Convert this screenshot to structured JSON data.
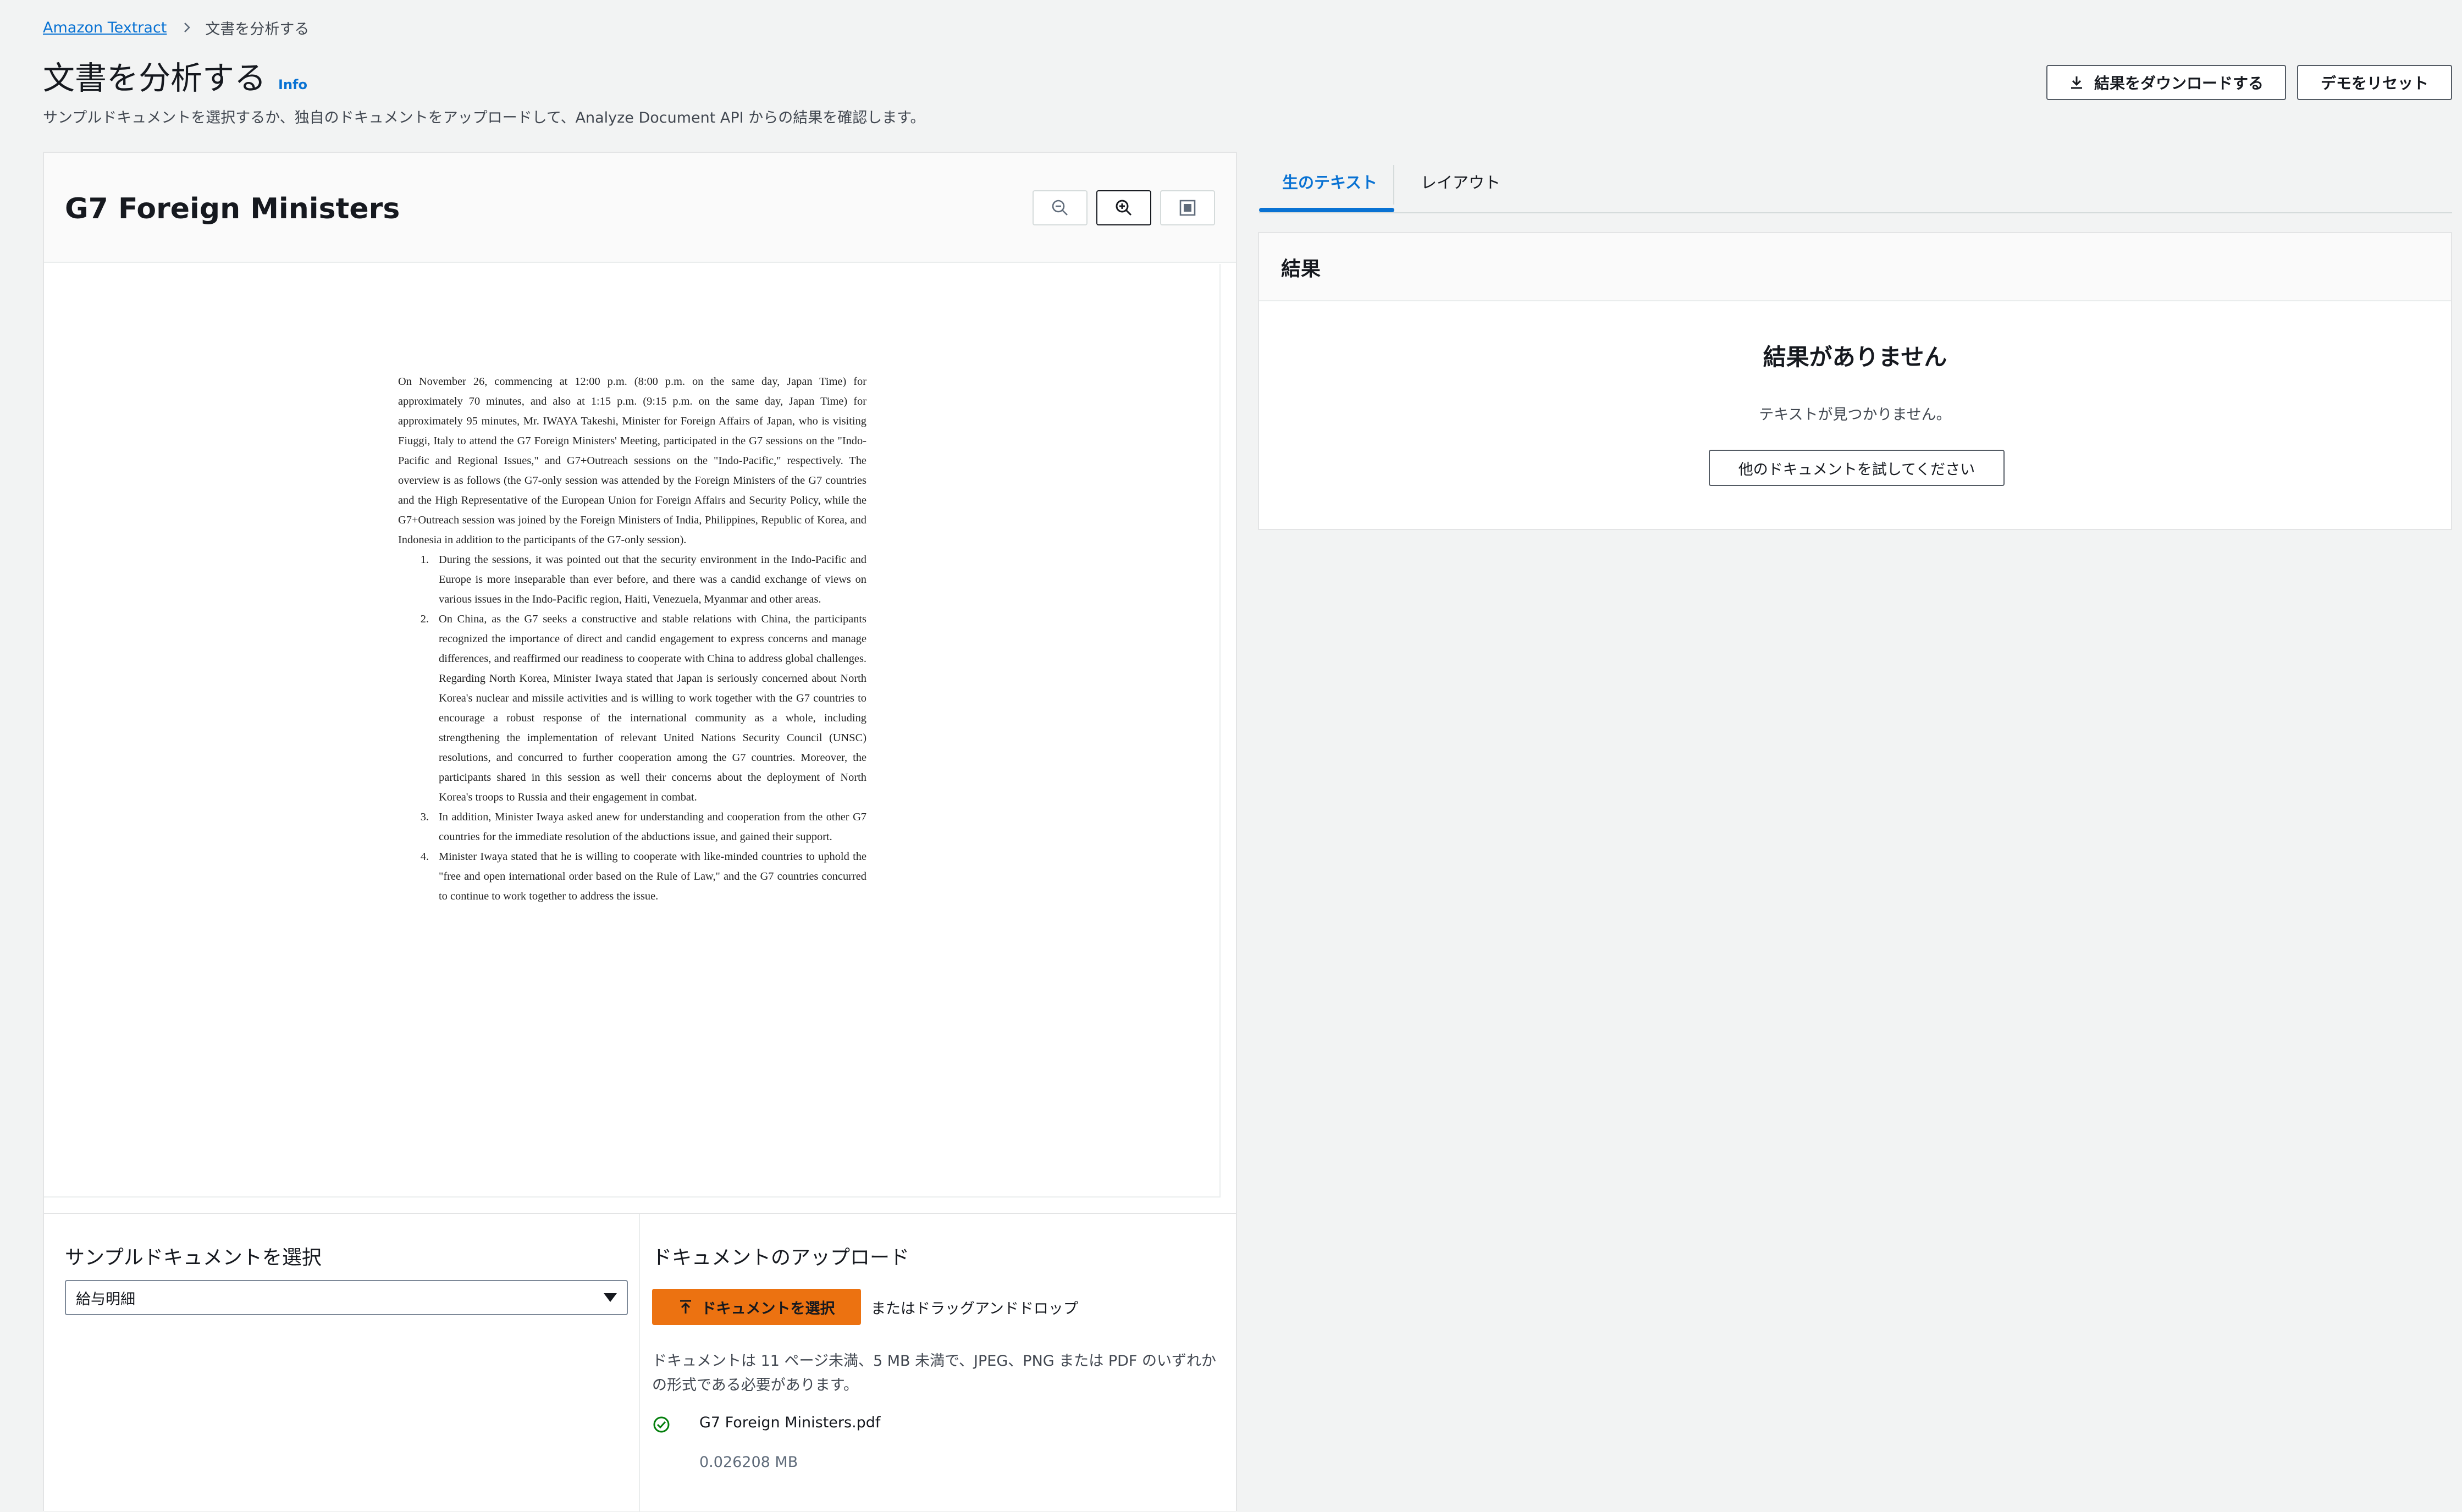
{
  "breadcrumb": {
    "root": "Amazon Textract",
    "current": "文書を分析する"
  },
  "header": {
    "title": "文書を分析する",
    "info": "Info",
    "description": "サンプルドキュメントを選択するか、独自のドキュメントをアップロードして、Analyze Document API からの結果を確認します。",
    "download_label": "結果をダウンロードする",
    "reset_label": "デモをリセット"
  },
  "document": {
    "title": "G7 Foreign Ministers",
    "intro": "On November 26, commencing at 12:00 p.m. (8:00 p.m. on the same day, Japan Time) for approximately 70 minutes, and also at 1:15 p.m. (9:15 p.m. on the same day, Japan Time) for approximately 95 minutes, Mr. IWAYA Takeshi, Minister for Foreign Affairs of Japan, who is visiting Fiuggi, Italy to attend the G7 Foreign Ministers' Meeting, participated in the G7 sessions on the \"Indo-Pacific and Regional Issues,\" and G7+Outreach sessions on the \"Indo-Pacific,\" respectively. The overview is as follows (the G7-only session was attended by the Foreign Ministers of the G7 countries and the High Representative of the European Union for Foreign Affairs and Security Policy, while the G7+Outreach session was joined by the Foreign Ministers of India, Philippines, Republic of Korea, and Indonesia in addition to the participants of the G7-only session).",
    "items": [
      {
        "num": "1.",
        "text": "During the sessions, it was pointed out that the security environment in the Indo-Pacific and Europe is more inseparable than ever before, and there was a candid exchange of views on various issues in the Indo-Pacific region, Haiti, Venezuela, Myanmar and other areas."
      },
      {
        "num": "2.",
        "text": "On China, as the G7 seeks a constructive and stable relations with China, the participants recognized the importance of direct and candid engagement to express concerns and manage differences, and reaffirmed our readiness to cooperate with China to address global challenges. Regarding North Korea, Minister Iwaya stated that Japan is seriously concerned about North Korea's nuclear and missile activities and is willing to work together with the G7 countries to encourage a robust response of the international community as a whole, including strengthening the implementation of relevant United Nations Security Council (UNSC) resolutions, and concurred to further cooperation among the G7 countries. Moreover, the participants shared in this session as well their concerns about the deployment of North Korea's troops to Russia and their engagement in combat."
      },
      {
        "num": "3.",
        "text": "In addition, Minister Iwaya asked anew for understanding and cooperation from the other G7 countries for the immediate resolution of the abductions issue, and gained their support."
      },
      {
        "num": "4.",
        "text": "Minister Iwaya stated that he is willing to cooperate with like-minded countries to uphold the \"free and open international order based on the Rule of Law,\" and the G7 countries concurred to continue to work together to address the issue."
      }
    ]
  },
  "sample": {
    "heading": "サンプルドキュメントを選択",
    "selected": "給与明細"
  },
  "upload": {
    "heading": "ドキュメントのアップロード",
    "choose_label": "ドキュメントを選択",
    "drag_text": "またはドラッグアンドドロップ",
    "constraint": "ドキュメントは 11 ページ未満、5 MB 未満で、JPEG、PNG または PDF のいずれかの形式である必要があります。",
    "file_name": "G7 Foreign Ministers.pdf",
    "file_size": "0.026208 MB"
  },
  "tabs": [
    {
      "label": "生のテキスト",
      "active": true
    },
    {
      "label": "レイアウト",
      "active": false
    }
  ],
  "results": {
    "title": "結果",
    "empty_title": "結果がありません",
    "empty_text": "テキストが見つかりません。",
    "try_other_label": "他のドキュメントを試してください"
  },
  "colors": {
    "link": "#0972d3",
    "primary_button": "#ec7211",
    "success": "#037f0c",
    "background": "#f2f3f3"
  },
  "icons": [
    "chevron-right-icon",
    "download-icon",
    "zoom-out-icon",
    "zoom-in-icon",
    "fit-page-icon",
    "upload-icon",
    "check-circle-icon",
    "caret-down-icon"
  ]
}
